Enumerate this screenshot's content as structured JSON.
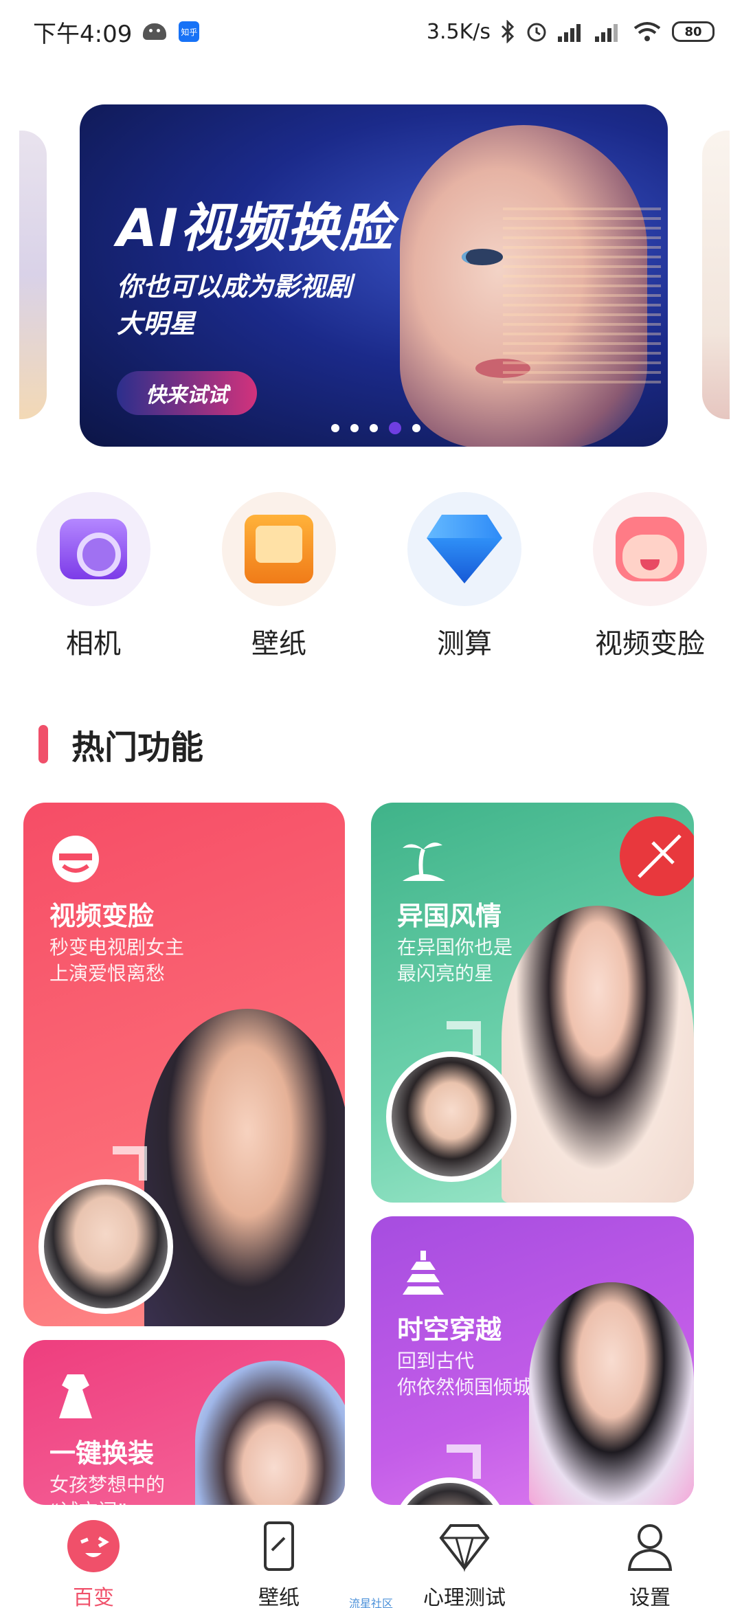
{
  "status_bar": {
    "time": "下午4:09",
    "zhihu_badge": "知乎",
    "speed": "3.5K/s",
    "battery": "80"
  },
  "banner": {
    "title": "AI视频换脸",
    "subtitle": "你也可以成为影视剧大明星",
    "button": "快来试试",
    "dots_total": 5,
    "active_dot": 4
  },
  "quick_entries": [
    {
      "label": "相机",
      "icon": "camera-icon"
    },
    {
      "label": "壁纸",
      "icon": "wallpaper-icon"
    },
    {
      "label": "测算",
      "icon": "diamond-icon"
    },
    {
      "label": "视频变脸",
      "icon": "face-icon"
    }
  ],
  "section": {
    "title": "热门功能"
  },
  "cards": [
    {
      "title": "视频变脸",
      "desc": "秒变电视剧女主\n上演爱恨离愁",
      "icon": "mask-icon"
    },
    {
      "title": "异国风情",
      "desc": "在异国你也是\n最闪亮的星",
      "icon": "palm-icon"
    },
    {
      "title": "时空穿越",
      "desc": "回到古代\n你依然倾国倾城",
      "icon": "pagoda-icon"
    },
    {
      "title": "一键换装",
      "desc": "女孩梦想中的\n“试衣间”",
      "icon": "dress-icon"
    }
  ],
  "bottom_nav": [
    {
      "label": "百变",
      "icon": "wink-face-icon",
      "active": true
    },
    {
      "label": "壁纸",
      "icon": "phone-icon",
      "active": false
    },
    {
      "label": "心理测试",
      "icon": "diamond-outline-icon",
      "active": false
    },
    {
      "label": "设置",
      "icon": "user-icon",
      "active": false
    }
  ],
  "nav_hint": "流星社区",
  "colors": {
    "accent": "#f0506a",
    "card_red": "#f64d66",
    "card_green": "#3fb389",
    "card_purple": "#a64de0",
    "card_pink": "#ee3e7e"
  }
}
